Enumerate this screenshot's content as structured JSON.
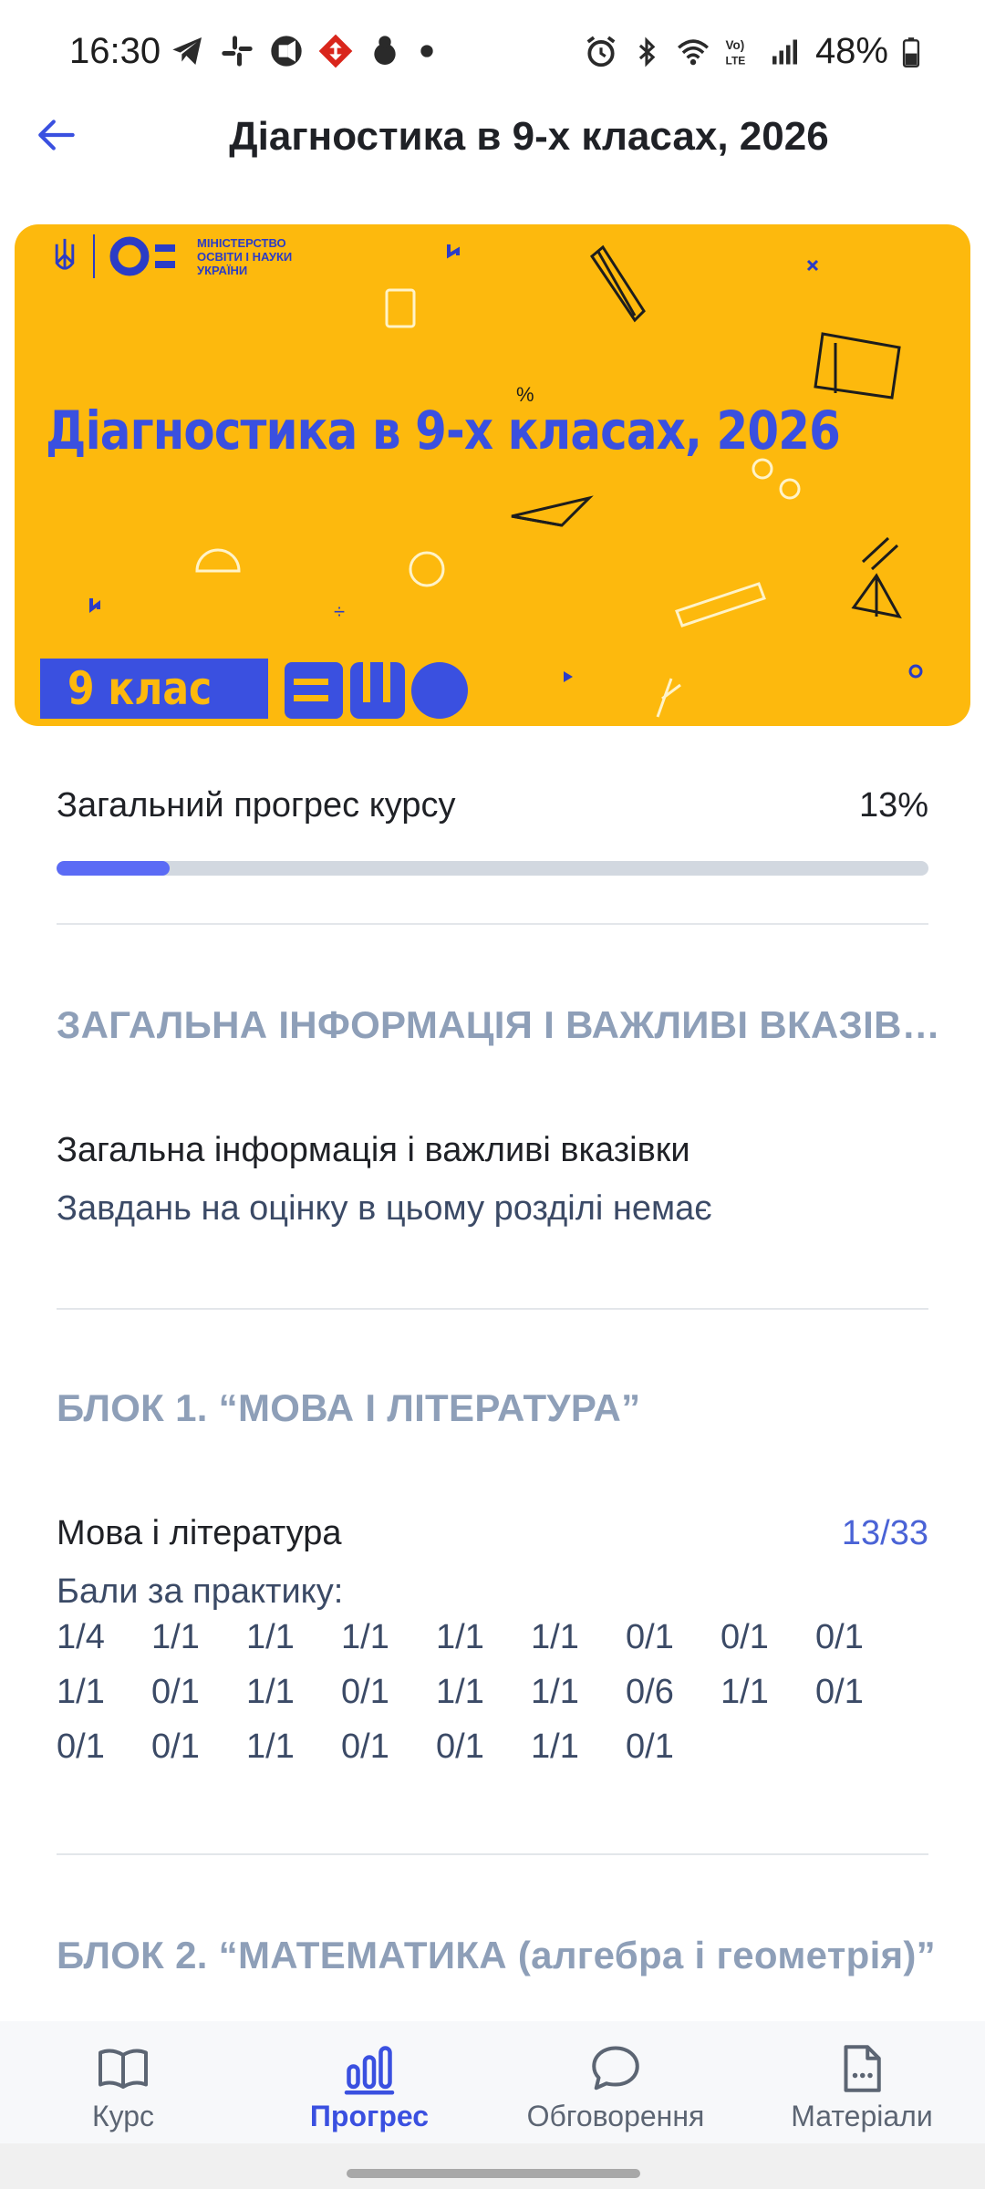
{
  "status_bar": {
    "time": "16:30",
    "battery_text": "48%",
    "left_icons": [
      "telegram-icon",
      "slack-icon",
      "record-icon",
      "nova-poshta-icon",
      "app-icon",
      "dot-icon"
    ],
    "right_icons": [
      "alarm-icon",
      "bluetooth-icon",
      "wifi-icon",
      "volte-icon",
      "signal-icon",
      "battery-icon"
    ]
  },
  "header": {
    "title": "Діагностика в 9-х класах, 2026",
    "back_icon": "arrow-left-icon"
  },
  "banner": {
    "title": "Діагностика в 9-х класах, 2026",
    "ministry_lines": [
      "МІНІСТЕРСТВО",
      "ОСВІТИ І НАУКИ",
      "УКРАЇНИ"
    ],
    "grade": "9 клас",
    "logo_text": "ВШО",
    "colors": {
      "background": "#fdb90d",
      "accent": "#3a50e0"
    }
  },
  "progress": {
    "label": "Загальний прогрес курсу",
    "percent_text": "13%",
    "value": 13
  },
  "sections": [
    {
      "title": "ЗАГАЛЬНА ІНФОРМАЦІЯ І ВАЖЛИВІ ВКАЗІВКИ",
      "item_title": "Загальна інформація і важливі вказівки",
      "item_note": "Завдань на оцінку в цьому розділі немає"
    },
    {
      "title": "БЛОК 1. “МОВА І ЛІТЕРАТУРА”",
      "item_title": "Мова і література",
      "item_score": "13/33",
      "practice_label": "Бали за практику:",
      "practice_scores": [
        [
          "1/4",
          "1/1",
          "1/1",
          "1/1",
          "1/1",
          "1/1",
          "0/1",
          "0/1",
          "0/1"
        ],
        [
          "1/1",
          "0/1",
          "1/1",
          "0/1",
          "1/1",
          "1/1",
          "0/6",
          "1/1",
          "0/1"
        ],
        [
          "0/1",
          "0/1",
          "1/1",
          "0/1",
          "0/1",
          "1/1",
          "0/1"
        ]
      ]
    },
    {
      "title": "БЛОК 2. “МАТЕМАТИКА (алгебра і геометрія)”"
    }
  ],
  "bottom_nav": [
    {
      "label": "Курс",
      "icon": "book-icon",
      "active": false
    },
    {
      "label": "Прогрес",
      "icon": "bar-chart-icon",
      "active": true
    },
    {
      "label": "Обговорення",
      "icon": "chat-bubble-icon",
      "active": false
    },
    {
      "label": "Матеріали",
      "icon": "document-icon",
      "active": false
    }
  ]
}
